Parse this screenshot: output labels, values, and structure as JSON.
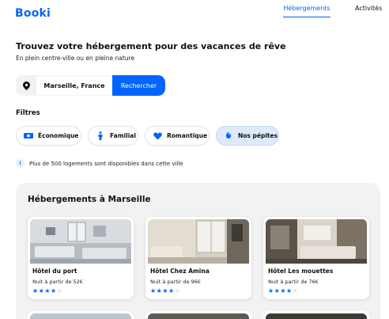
{
  "header": {
    "logo": "Booki",
    "nav": [
      {
        "label": "Hébergements",
        "active": true
      },
      {
        "label": "Activités",
        "active": false
      }
    ]
  },
  "hero": {
    "title": "Trouvez votre hébergement pour des vacances de rêve",
    "subtitle": "En plein centre-ville ou en pleine nature"
  },
  "search": {
    "icon": "location-pin-icon",
    "value": "Marseille, France",
    "button_label": "Rechercher"
  },
  "filters": {
    "label": "Filtres",
    "items": [
      {
        "label": "Économique",
        "icon": "money-icon",
        "selected": false
      },
      {
        "label": "Familial",
        "icon": "person-icon",
        "selected": false
      },
      {
        "label": "Romantique",
        "icon": "heart-icon",
        "selected": false
      },
      {
        "label": "Nos pépites",
        "icon": "hand-icon",
        "selected": true
      }
    ]
  },
  "info": {
    "icon": "info-icon",
    "text": "Plus de 500 logements sont disponibles dans cette ville"
  },
  "listings": {
    "title": "Hébergements à Marseille",
    "cards": [
      {
        "name": "Hôtel du port",
        "price": "Nuit à partir de 52€",
        "rating": 4,
        "max_rating": 5
      },
      {
        "name": "Hôtel Chez Amina",
        "price": "Nuit à partir de 96€",
        "rating": 4,
        "max_rating": 5
      },
      {
        "name": "Hôtel Les mouettes",
        "price": "Nuit à partir de 76€",
        "rating": 4,
        "max_rating": 5
      }
    ]
  },
  "colors": {
    "accent": "#0065fc",
    "panel": "#f2f2f2",
    "chip_selected": "#dee9fb"
  }
}
